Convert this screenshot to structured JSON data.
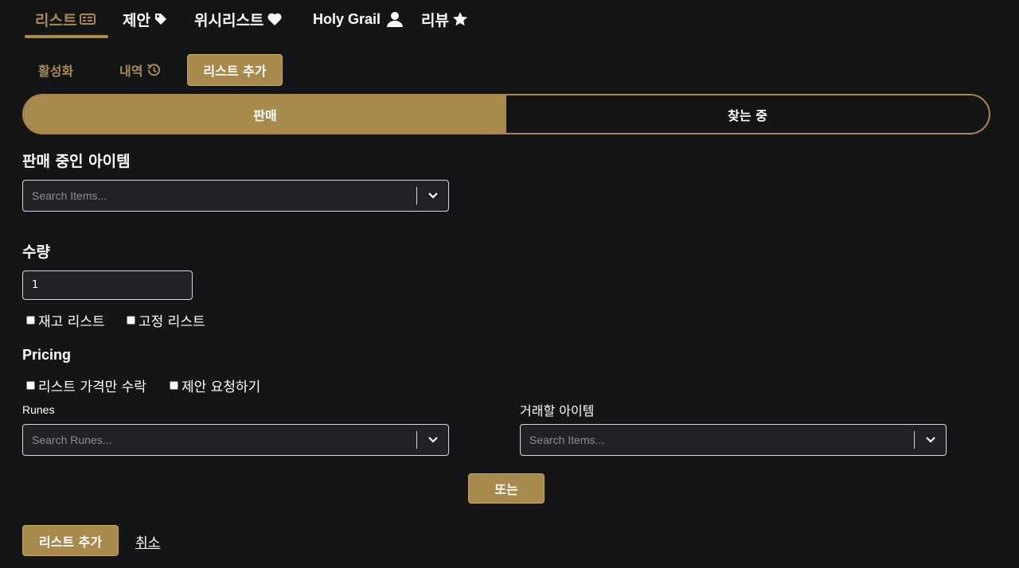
{
  "nav": {
    "items": [
      {
        "label": "리스트",
        "icon": "list-card-icon"
      },
      {
        "label": "제안",
        "icon": "tag-icon"
      },
      {
        "label": "위시리스트",
        "icon": "heart-icon"
      },
      {
        "label": "Holy Grail",
        "icon": "user-icon"
      },
      {
        "label": "리뷰",
        "icon": "star-icon"
      }
    ]
  },
  "subtabs": {
    "active": "활성화",
    "history": "내역",
    "add_listing": "리스트 추가"
  },
  "mode": {
    "sell": "판매",
    "looking": "찾는 중"
  },
  "items_section": {
    "title": "판매 중인 아이템",
    "placeholder": "Search Items..."
  },
  "quantity": {
    "title": "수량",
    "value": "1"
  },
  "checks": {
    "inventory": "재고 리스트",
    "fixed": "고정 리스트"
  },
  "pricing": {
    "title": "Pricing",
    "accept_only": "리스트 가격만 수락",
    "request_offer": "제안 요청하기",
    "runes_label": "Runes",
    "runes_placeholder": "Search Runes...",
    "trade_label": "거래할 아이템",
    "trade_placeholder": "Search Items...",
    "or": "또는"
  },
  "footer": {
    "submit": "리스트 추가",
    "cancel": "취소"
  },
  "colors": {
    "accent": "#a88a4c",
    "background": "#141517",
    "field": "#212226"
  }
}
